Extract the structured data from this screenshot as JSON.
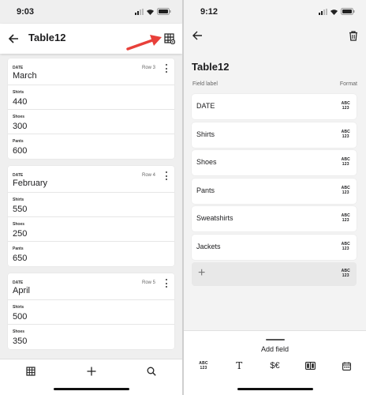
{
  "left": {
    "status": {
      "time": "9:03"
    },
    "header": {
      "title": "Table12"
    },
    "cards": [
      {
        "date_label": "DATE",
        "date": "March",
        "row": "Row 3",
        "fields": [
          {
            "label": "Shirts",
            "value": "440"
          },
          {
            "label": "Shoes",
            "value": "300"
          },
          {
            "label": "Pants",
            "value": "600"
          }
        ]
      },
      {
        "date_label": "DATE",
        "date": "February",
        "row": "Row 4",
        "fields": [
          {
            "label": "Shirts",
            "value": "550"
          },
          {
            "label": "Shoes",
            "value": "250"
          },
          {
            "label": "Pants",
            "value": "650"
          }
        ]
      },
      {
        "date_label": "DATE",
        "date": "April",
        "row": "Row 5",
        "fields": [
          {
            "label": "Shirts",
            "value": "500"
          },
          {
            "label": "Shoes",
            "value": "350"
          }
        ]
      }
    ],
    "bottom_nav": [
      "table-icon",
      "add-icon",
      "search-icon"
    ],
    "arrow_color": "#e8403a"
  },
  "right": {
    "status": {
      "time": "9:12"
    },
    "title": "Table12",
    "col_field": "Field label",
    "col_format": "Format",
    "format_abbr": {
      "top": "ABC",
      "bottom": "123"
    },
    "fields": [
      "DATE",
      "Shirts",
      "Shoes",
      "Pants",
      "Sweatshirts",
      "Jackets"
    ],
    "sheet": {
      "title": "Add field",
      "text_glyph": "T",
      "currency_glyph": "$€"
    }
  }
}
